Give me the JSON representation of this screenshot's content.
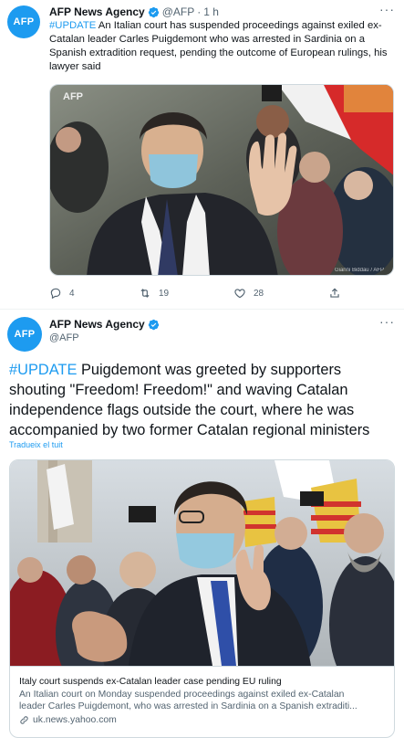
{
  "tweet1": {
    "avatar_text": "AFP",
    "name": "AFP News Agency",
    "handle": "@AFP",
    "separator": "·",
    "time": "1 h",
    "hashtag": "#UPDATE",
    "text": " An Italian court has suspended proceedings against exiled ex-Catalan leader Carles Puigdemont who was arrested in Sardinia on a Spanish extradition request, pending the outcome of European rulings, his lawyer said",
    "image_watermark": "AFP",
    "image_credit": "Gianni Biddau / AFP",
    "actions": {
      "replies": "4",
      "retweets": "19",
      "likes": "28"
    }
  },
  "tweet2": {
    "avatar_text": "AFP",
    "name": "AFP News Agency",
    "handle": "@AFP",
    "hashtag": "#UPDATE",
    "text": " Puigdemont was greeted by supporters shouting \"Freedom! Freedom!\" and waving Catalan independence flags outside the court, where he was accompanied by two former Catalan regional ministers",
    "translate_label": "Tradueix el tuit",
    "card": {
      "title": "Italy court suspends ex-Catalan leader case pending EU ruling",
      "description_line1": "An Italian court on Monday suspended proceedings against exiled ex-Catalan",
      "description_line2": "leader Carles Puigdemont, who was arrested in Sardinia on a Spanish extraditi...",
      "domain": "uk.news.yahoo.com"
    }
  },
  "colors": {
    "accent": "#1d9bf0",
    "text": "#0f1419",
    "muted": "#536471",
    "border": "#cfd9de"
  }
}
